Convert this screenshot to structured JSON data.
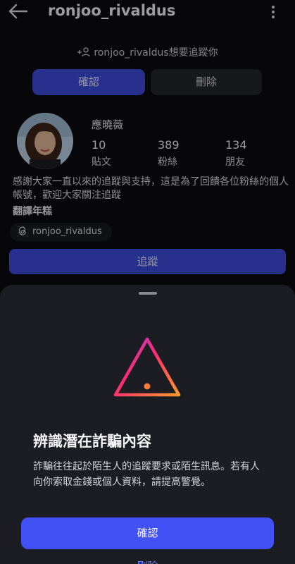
{
  "header": {
    "username": "ronjoo_rivaldus",
    "back_icon": "arrow-left-icon",
    "menu_icon": "more-vertical-icon"
  },
  "follow_request": {
    "text": "ronjoo_rivaldus想要追蹤你",
    "icon": "add-person-icon",
    "confirm_label": "確認",
    "delete_label": "刪除"
  },
  "profile": {
    "display_name": "應曉薇",
    "stats": [
      {
        "value": "10",
        "label": "貼文"
      },
      {
        "value": "389",
        "label": "粉絲"
      },
      {
        "value": "134",
        "label": "朋友"
      }
    ],
    "bio": "感謝大家一直以來的追蹤與支持，這是為了回饋各位粉絲的個人帳號，歡迎大家關注追蹤",
    "translate_label": "翻譯年糕",
    "threads_handle": "ronjoo_rivaldus",
    "threads_icon": "threads-icon",
    "follow_label": "追蹤"
  },
  "sheet": {
    "icon": "warning-triangle-icon",
    "title": "辨識潛在詐騙內容",
    "body": "詐騙往往起於陌生人的追蹤要求或陌生訊息。若有人向你索取金錢或個人資料，請提高警覺。",
    "confirm_label": "確認",
    "delete_label": "刪除"
  },
  "colors": {
    "primary_blue": "#4151f5",
    "background": "#0b0c10",
    "sheet_background": "#1c1d22"
  }
}
